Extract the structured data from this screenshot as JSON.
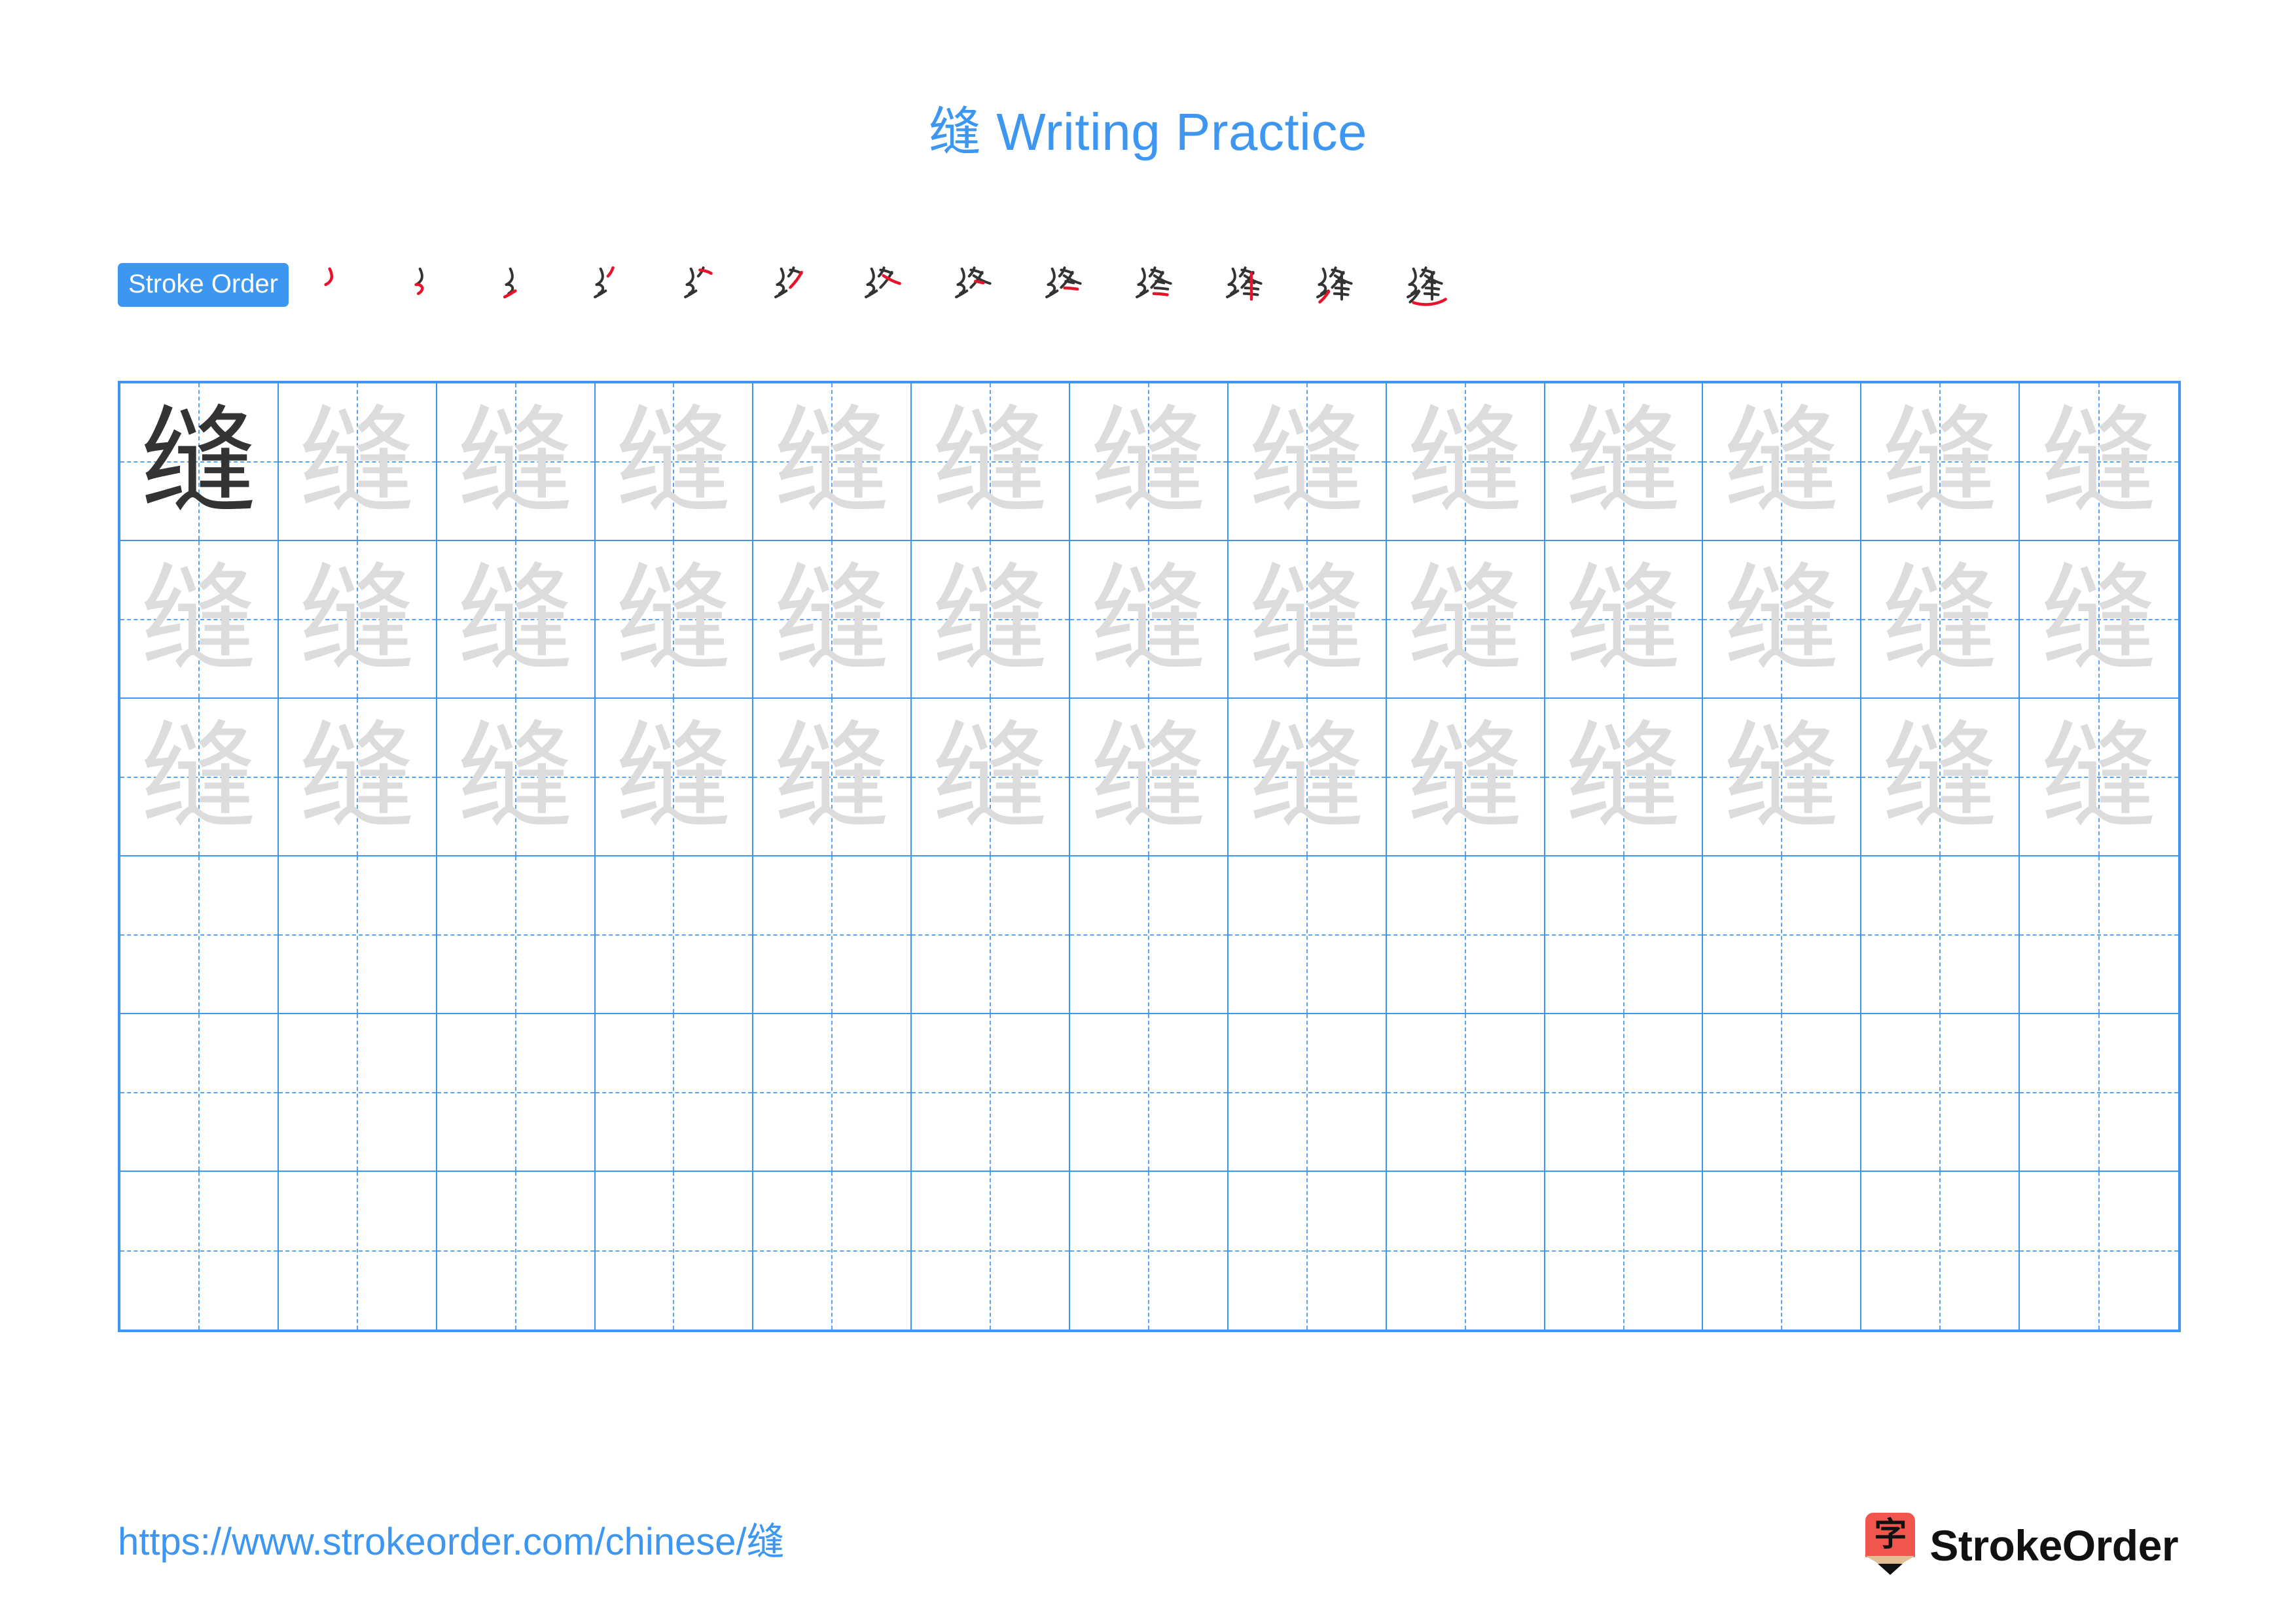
{
  "page": {
    "character": "缝",
    "title_suffix": " Writing Practice",
    "accent_color": "#3d96f0",
    "grid_line_color": "#3d96f0",
    "guide_line_color": "#58a3f2",
    "dark_glyph_color": "#333333",
    "faint_glyph_color": "#dcdcdc",
    "stroke_new_color": "#e8132a",
    "stroke_old_color": "#333333"
  },
  "header": {
    "title": "缝 Writing Practice"
  },
  "stroke_order": {
    "badge_label": "Stroke Order",
    "stroke_count": 13,
    "steps": [
      {
        "index": 1,
        "strokes_drawn": 1,
        "new_stroke": 1
      },
      {
        "index": 2,
        "strokes_drawn": 2,
        "new_stroke": 2
      },
      {
        "index": 3,
        "strokes_drawn": 3,
        "new_stroke": 3
      },
      {
        "index": 4,
        "strokes_drawn": 4,
        "new_stroke": 4
      },
      {
        "index": 5,
        "strokes_drawn": 5,
        "new_stroke": 5
      },
      {
        "index": 6,
        "strokes_drawn": 6,
        "new_stroke": 6
      },
      {
        "index": 7,
        "strokes_drawn": 7,
        "new_stroke": 7
      },
      {
        "index": 8,
        "strokes_drawn": 8,
        "new_stroke": 8
      },
      {
        "index": 9,
        "strokes_drawn": 9,
        "new_stroke": 9
      },
      {
        "index": 10,
        "strokes_drawn": 10,
        "new_stroke": 10
      },
      {
        "index": 11,
        "strokes_drawn": 11,
        "new_stroke": 11
      },
      {
        "index": 12,
        "strokes_drawn": 12,
        "new_stroke": 12
      },
      {
        "index": 13,
        "strokes_drawn": 13,
        "new_stroke": 13
      }
    ]
  },
  "practice_grid": {
    "columns": 13,
    "rows": 6,
    "rows_data": [
      {
        "row": 1,
        "cells": [
          "dark",
          "faint",
          "faint",
          "faint",
          "faint",
          "faint",
          "faint",
          "faint",
          "faint",
          "faint",
          "faint",
          "faint",
          "faint"
        ]
      },
      {
        "row": 2,
        "cells": [
          "faint",
          "faint",
          "faint",
          "faint",
          "faint",
          "faint",
          "faint",
          "faint",
          "faint",
          "faint",
          "faint",
          "faint",
          "faint"
        ]
      },
      {
        "row": 3,
        "cells": [
          "faint",
          "faint",
          "faint",
          "faint",
          "faint",
          "faint",
          "faint",
          "faint",
          "faint",
          "faint",
          "faint",
          "faint",
          "faint"
        ]
      },
      {
        "row": 4,
        "cells": [
          "empty",
          "empty",
          "empty",
          "empty",
          "empty",
          "empty",
          "empty",
          "empty",
          "empty",
          "empty",
          "empty",
          "empty",
          "empty"
        ]
      },
      {
        "row": 5,
        "cells": [
          "empty",
          "empty",
          "empty",
          "empty",
          "empty",
          "empty",
          "empty",
          "empty",
          "empty",
          "empty",
          "empty",
          "empty",
          "empty"
        ]
      },
      {
        "row": 6,
        "cells": [
          "empty",
          "empty",
          "empty",
          "empty",
          "empty",
          "empty",
          "empty",
          "empty",
          "empty",
          "empty",
          "empty",
          "empty",
          "empty"
        ]
      }
    ]
  },
  "footer": {
    "url": "https://www.strokeorder.com/chinese/缝",
    "brand_name": "StrokeOrder",
    "logo_character": "字",
    "logo_body_color": "#f0564e",
    "logo_wood_color": "#e3bd94",
    "logo_tip_color": "#111111"
  }
}
